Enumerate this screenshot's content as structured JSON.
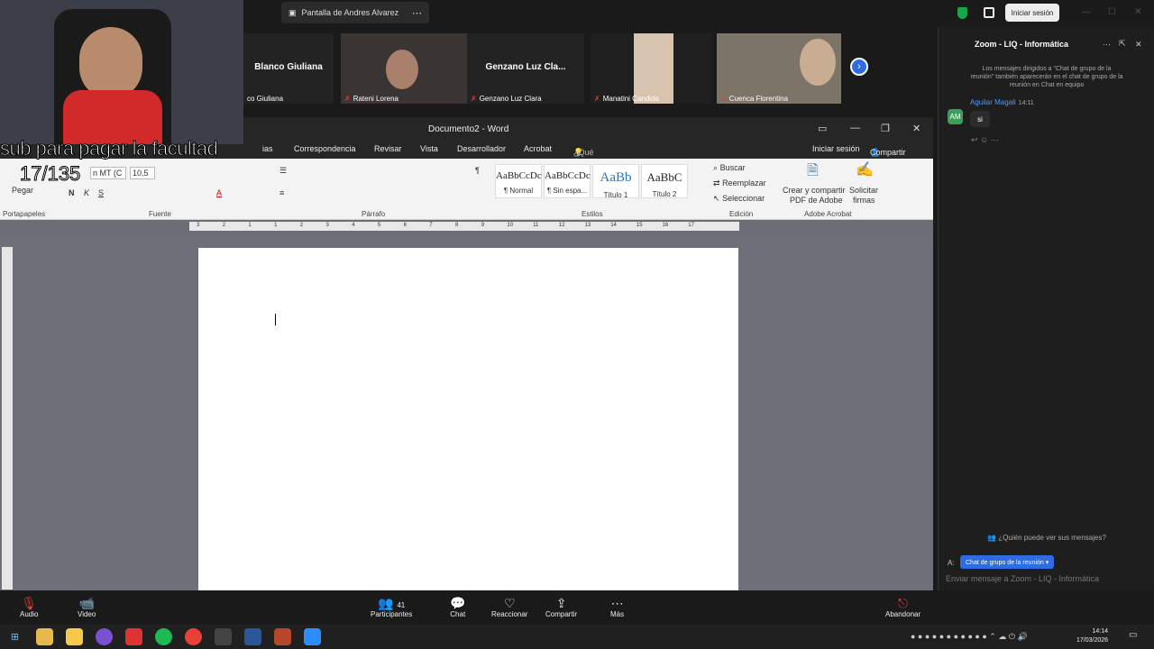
{
  "topbar": {
    "share_label": "Pantalla de Andres Alvarez",
    "signin": "Iniciar sesión"
  },
  "participants": [
    {
      "name": "co Giuliana",
      "big": "Blanco Giuliana"
    },
    {
      "name": "Rateni Lorena"
    },
    {
      "name": "Genzano Luz Clara",
      "big": "Genzano  Luz  Cla..."
    },
    {
      "name": "Manatini Candida"
    },
    {
      "name": "Cuenca Florentina"
    }
  ],
  "overlay": {
    "line1": "sub para pagar la facultad",
    "line2": "17/135"
  },
  "word": {
    "title": "Documento2 - Word",
    "menu": {
      "m1": "ias",
      "m2": "Correspondencia",
      "m3": "Revisar",
      "m4": "Vista",
      "m5": "Desarrollador",
      "m6": "Acrobat",
      "search": "¿Qué desea hacer?",
      "signin": "Iniciar sesión",
      "share": "Compartir"
    },
    "ribbon": {
      "paste": "Pegar",
      "font": "n MT (C",
      "size": "10,5",
      "styles": [
        {
          "sample": "AaBbCcDc",
          "name": "¶ Normal"
        },
        {
          "sample": "AaBbCcDc",
          "name": "¶ Sin espa..."
        },
        {
          "sample": "AaBb",
          "name": "Título 1"
        },
        {
          "sample": "AaBbC",
          "name": "Título 2"
        }
      ],
      "buscar": "Buscar",
      "reemplazar": "Reemplazar",
      "seleccionar": "Seleccionar",
      "acrobat1": "Crear y compartir",
      "acrobat2": "PDF de Adobe",
      "firmas1": "Solicitar",
      "firmas2": "firmas",
      "groups": {
        "g1": "Portapapeles",
        "g2": "Fuente",
        "g3": "Párrafo",
        "g4": "Estilos",
        "g5": "Edición",
        "g6": "Adobe Acrobat"
      }
    },
    "ruler_ticks": [
      "3",
      "2",
      "1",
      "1",
      "2",
      "3",
      "4",
      "5",
      "6",
      "7",
      "8",
      "9",
      "10",
      "11",
      "12",
      "13",
      "14",
      "15",
      "16",
      "17"
    ]
  },
  "chat": {
    "title": "Zoom - LIQ - Informática",
    "note": "Los mensajes dirigidos a \"Chat de grupo de la reunión\" también aparecerán en el chat de grupo de la reunión en Chat en equipo",
    "avatar": "AM",
    "sender": "Aguilar Magali",
    "time": "14:11",
    "message": "si",
    "who": "¿Quién puede ver sus mensajes?",
    "to_label": "A:",
    "to_chip": "Chat de grupo de la reunión ▾",
    "placeholder": "Enviar mensaje a Zoom - LIQ - Informática"
  },
  "controls": {
    "audio": "Audio",
    "video": "Video",
    "participants": "Participantes",
    "participants_count": "41",
    "chat": "Chat",
    "react": "Reaccionar",
    "share": "Compartir",
    "more": "Más",
    "leave": "Abandonar"
  },
  "clock": {
    "time": "14:14",
    "date": "17/03/2026"
  }
}
